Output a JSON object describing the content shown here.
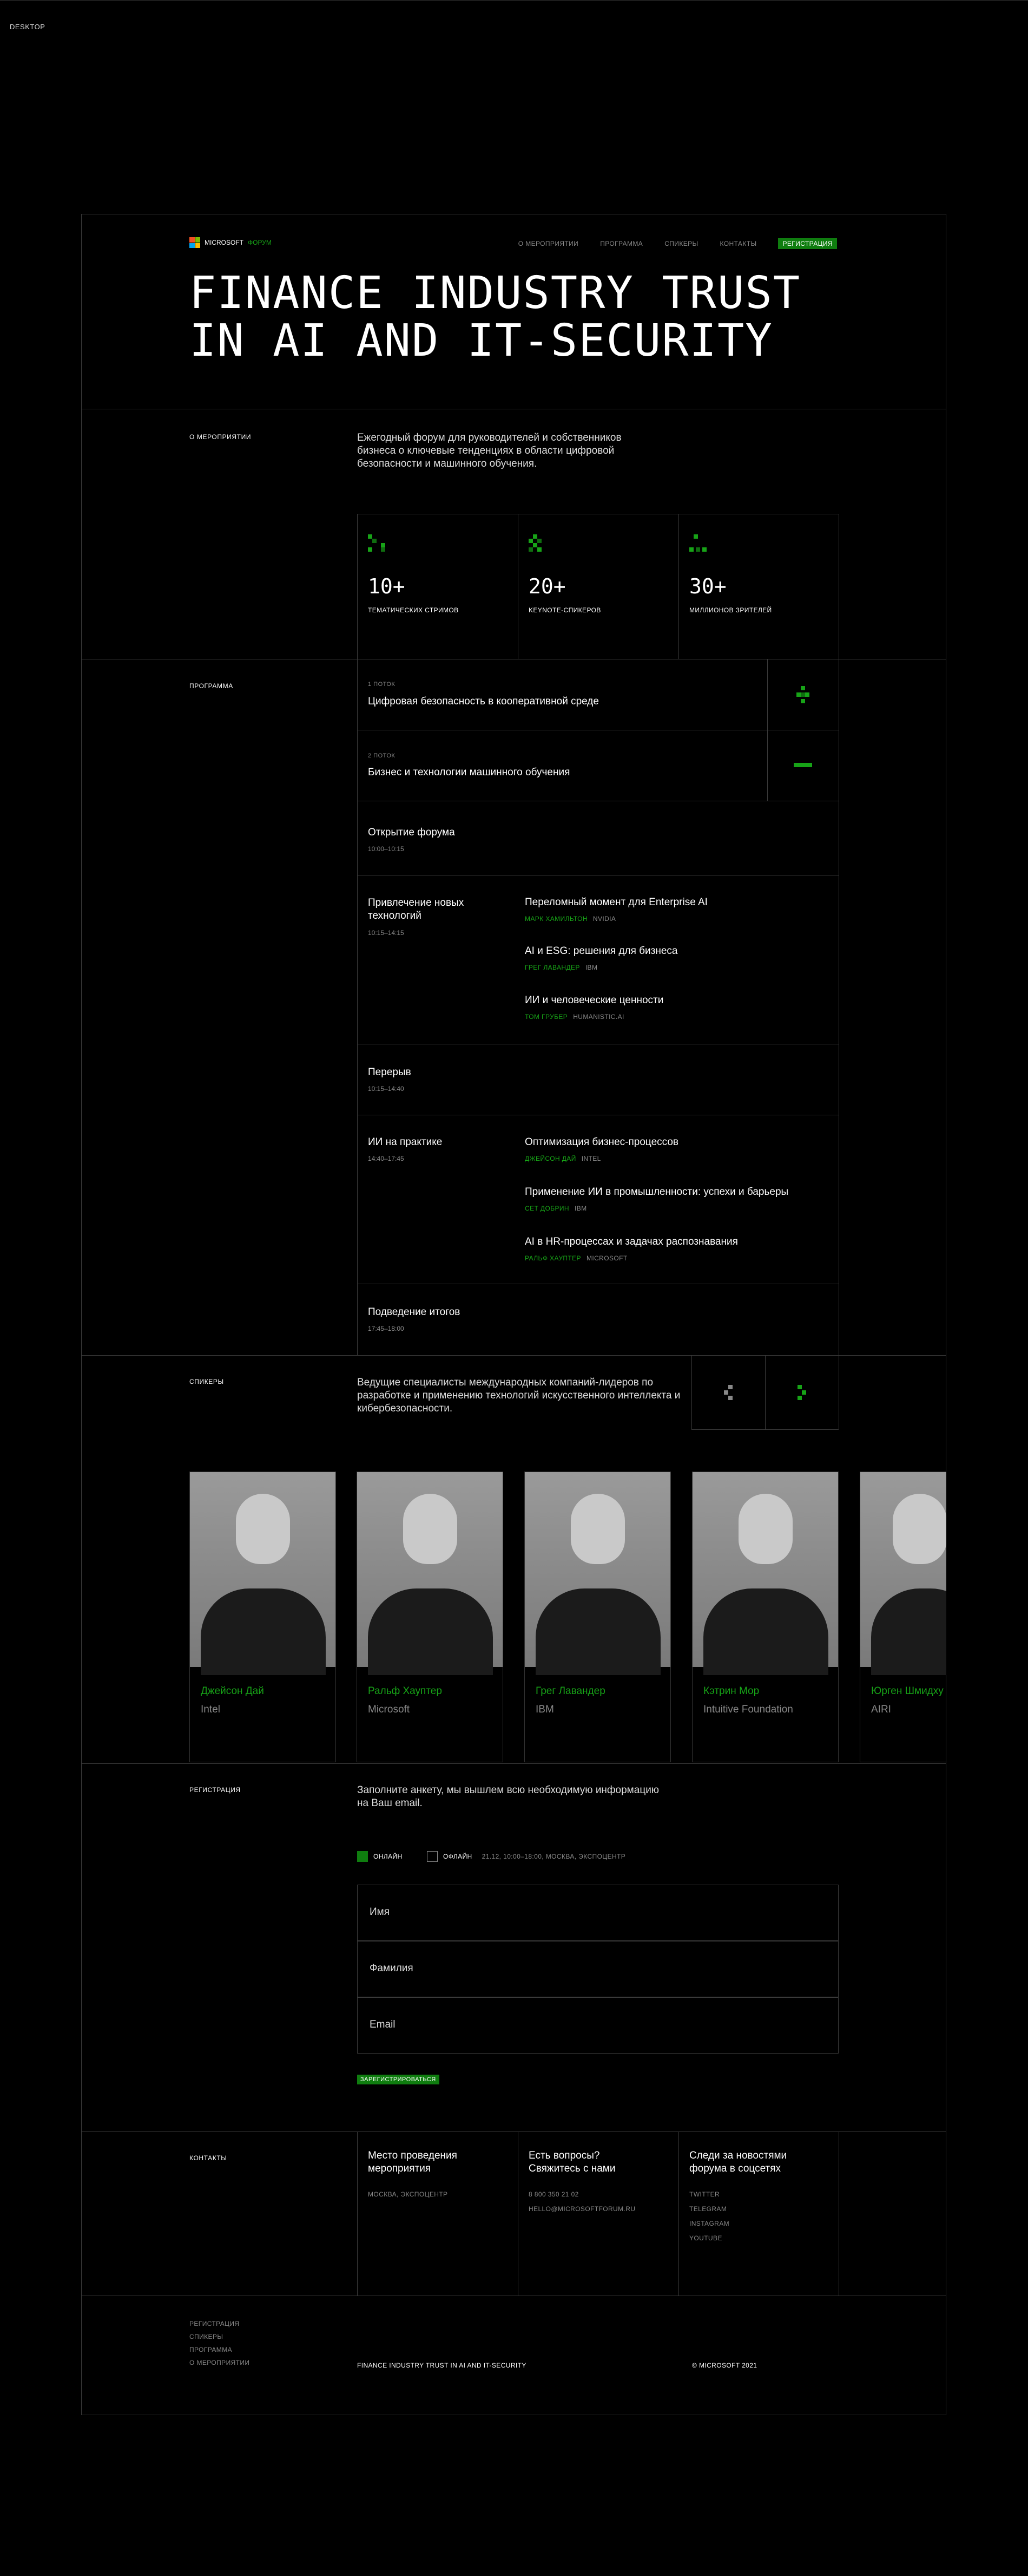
{
  "page_label": "DESKTOP",
  "brand": {
    "name": "MICROSOFT",
    "sub": "ФОРУМ",
    "colors": [
      "#f25022",
      "#7fba00",
      "#00a4ef",
      "#ffb900"
    ]
  },
  "nav": {
    "items": [
      "О МЕРОПРИЯТИИ",
      "ПРОГРАММА",
      "СПИКЕРЫ",
      "КОНТАКТЫ"
    ],
    "register": "РЕГИСТРАЦИЯ"
  },
  "hero": {
    "title": "FINANCE INDUSTRY TRUST\nIN AI AND IT-SECURITY"
  },
  "about": {
    "label": "О МЕРОПРИЯТИИ",
    "text": "Ежегодный форум для руководителей и собственников бизнеса о ключевые тенденциях в области цифровой безопасности и машинного обучения.",
    "stats": [
      {
        "value": "10+",
        "caption": "ТЕМАТИЧЕСКИХ СТРИМОВ",
        "icon": "pixel-icon"
      },
      {
        "value": "20+",
        "caption": "KEYNOTE-СПИКЕРОВ",
        "icon": "pixel-icon"
      },
      {
        "value": "30+",
        "caption": "МИЛЛИОНОВ ЗРИТЕЛЕЙ",
        "icon": "pixel-icon"
      }
    ]
  },
  "program": {
    "label": "ПРОГРАММА",
    "streams": [
      {
        "label": "1 ПОТОК",
        "title": "Цифровая безопасность в кооперативной среде",
        "toggle": "expand-icon"
      },
      {
        "label": "2 ПОТОК",
        "title": "Бизнес и технологии машинного обучения",
        "toggle": "collapse-icon"
      }
    ],
    "sessions": [
      {
        "title": "Открытие форума",
        "time": "10:00–10:15",
        "talks": []
      },
      {
        "title": "Привлечение новых технологий",
        "time": "10:15–14:15",
        "talks": [
          {
            "title": "Переломный момент для Enterprise AI",
            "speaker": "МАРК ХАМИЛЬТОН",
            "company": "NVIDIA"
          },
          {
            "title": "AI и ESG: решения для бизнеса",
            "speaker": "ГРЕГ ЛАВАНДЕР",
            "company": "IBM"
          },
          {
            "title": "ИИ и человеческие ценности",
            "speaker": "ТОМ ГРУБЕР",
            "company": "HUMANISTIC.AI"
          }
        ]
      },
      {
        "title": "Перерыв",
        "time": "10:15–14:40",
        "talks": []
      },
      {
        "title": "ИИ на практике",
        "time": "14:40–17:45",
        "talks": [
          {
            "title": "Оптимизация бизнес-процессов",
            "speaker": "ДЖЕЙСОН ДАЙ",
            "company": "INTEL"
          },
          {
            "title": "Применение ИИ в промышленности: успехи и барьеры",
            "speaker": "СЕТ ДОБРИН",
            "company": "IBM"
          },
          {
            "title": "AI в HR-процессах и задачах распознавания",
            "speaker": "РАЛЬФ ХАУПТЕР",
            "company": "MICROSOFT"
          }
        ]
      },
      {
        "title": "Подведение итогов",
        "time": "17:45–18:00",
        "talks": []
      }
    ]
  },
  "speakers": {
    "label": "СПИКЕРЫ",
    "text": "Ведущие специалисты международных компаний-лидеров по разработке и применению технологий искусственного интеллекта и кибербезопасности.",
    "prev_icon": "arrow-left-icon",
    "next_icon": "arrow-right-icon",
    "cards": [
      {
        "name": "Джейсон Дай",
        "company": "Intel"
      },
      {
        "name": "Ральф Хауптер",
        "company": "Microsoft"
      },
      {
        "name": "Грег Лавандер",
        "company": "IBM"
      },
      {
        "name": "Кэтрин Мор",
        "company": "Intuitive Foundation"
      },
      {
        "name": "Юрген Шмидху",
        "company": "AIRI"
      }
    ]
  },
  "registration": {
    "label": "РЕГИСТРАЦИЯ",
    "text": "Заполните анкету, мы вышлем всю необходимую информацию на Ваш email.",
    "online": "ОНЛАЙН",
    "offline": "ОФЛАЙН",
    "offline_note": "21.12, 10:00–18:00, МОСКВА, ЭКСПОЦЕНТР",
    "fields": {
      "first_name": "Имя",
      "last_name": "Фамилия",
      "email": "Email"
    },
    "submit": "ЗАРЕГИСТРИРОВАТЬСЯ"
  },
  "contacts": {
    "label": "КОНТАКТЫ",
    "columns": [
      {
        "title": "Место проведения мероприятия",
        "lines": [
          "МОСКВА, ЭКСПОЦЕНТР"
        ]
      },
      {
        "title": "Есть вопросы? Свяжитесь с нами",
        "lines": [
          "8 800 350 21 02",
          "HELLO@MICROSOFTFORUM.RU"
        ]
      },
      {
        "title": "Следи за новостями форума в соцсетях",
        "lines": [
          "TWITTER",
          "TELEGRAM",
          "INSTAGRAM",
          "YOUTUBE"
        ]
      }
    ]
  },
  "footer": {
    "links": [
      "РЕГИСТРАЦИЯ",
      "СПИКЕРЫ",
      "ПРОГРАММА",
      "О МЕРОПРИЯТИИ"
    ],
    "title": "FINANCE INDUSTRY TRUST IN AI AND IT-SECURITY",
    "copyright": "© MICROSOFT 2021"
  }
}
